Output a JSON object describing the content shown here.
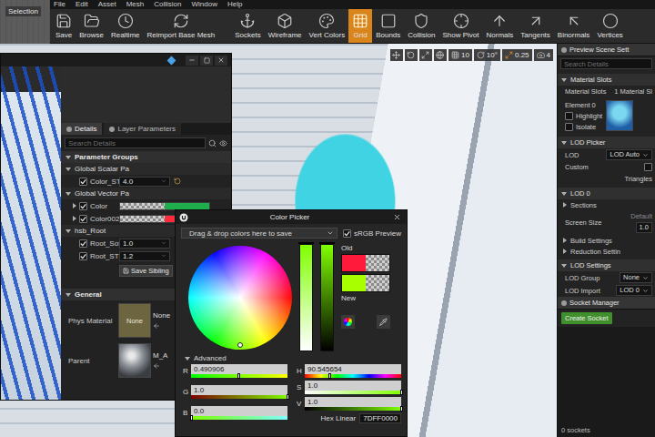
{
  "menu": [
    "File",
    "Edit",
    "Asset",
    "Mesh",
    "Collision",
    "Window",
    "Help"
  ],
  "corner_label": "Selection",
  "toolbar": [
    {
      "label": "Save",
      "selected": false
    },
    {
      "label": "Browse",
      "selected": false
    },
    {
      "label": "Realtime",
      "selected": false
    },
    {
      "label": "Reimport Base Mesh",
      "selected": false
    },
    {
      "label": "Sockets",
      "selected": false
    },
    {
      "label": "Wireframe",
      "selected": false
    },
    {
      "label": "Vert Colors",
      "selected": false
    },
    {
      "label": "Grid",
      "selected": true
    },
    {
      "label": "Bounds",
      "selected": false
    },
    {
      "label": "Collision",
      "selected": false
    },
    {
      "label": "Show Pivot",
      "selected": false
    },
    {
      "label": "Normals",
      "selected": false
    },
    {
      "label": "Tangents",
      "selected": false
    },
    {
      "label": "Binormals",
      "selected": false
    },
    {
      "label": "Vertices",
      "selected": false
    }
  ],
  "viewport_toolbar": [
    {
      "label": "10",
      "selected": false
    },
    {
      "label": "10°",
      "selected": false
    },
    {
      "label": "0.25",
      "selected": true
    },
    {
      "label": "4",
      "selected": false
    }
  ],
  "preview_scene": {
    "tab": "Preview Scene Sett",
    "search_placeholder": "Search Details",
    "material_slots": {
      "header": {
        "label": "Material Slots",
        "expanded": true
      },
      "label": "Material Slots",
      "value": "1 Material Sl",
      "element": "Element 0",
      "checkboxes": [
        {
          "label": "Highlight",
          "checked": false
        },
        {
          "label": "Isolate",
          "checked": false
        }
      ]
    },
    "lod_picker": {
      "header": {
        "label": "LOD Picker",
        "expanded": true
      },
      "lod_label": "LOD",
      "lod_value": "LOD Auto",
      "custom_label": "Custom",
      "custom_checked": false,
      "triangles": "Triangles"
    },
    "lod0": {
      "header": {
        "label": "LOD 0",
        "expanded": true
      },
      "first_group": {
        "label": "Sections",
        "expanded": false
      },
      "screen_size_label": "Screen Size",
      "screen_size_hint": "Default",
      "screen_size_value": "1.0",
      "more_groups": [
        {
          "label": "Build Settings",
          "expanded": false
        },
        {
          "label": "Reduction Settin",
          "expanded": false
        }
      ]
    },
    "lod_settings": {
      "header": {
        "label": "LOD Settings",
        "expanded": true
      },
      "rows": [
        {
          "label": "LOD Group",
          "value": "None"
        },
        {
          "label": "LOD Import",
          "value": "LOD 0"
        }
      ]
    },
    "socket_manager": {
      "tab": "Socket Manager",
      "button": "Create Socket",
      "count": "0 sockets"
    }
  },
  "material_editor": {
    "tabs": [
      {
        "label": "Details",
        "selected": true
      },
      {
        "label": "Layer Parameters",
        "selected": false
      }
    ],
    "search_placeholder": "Search Details",
    "parameter_groups_header": {
      "label": "Parameter Groups",
      "expanded": true
    },
    "groups": [
      {
        "label": "Global Scalar Pa",
        "expanded": true,
        "params": [
          {
            "kind": "scalar",
            "name": "Color_ST",
            "checked": true,
            "value": "4.0",
            "modified": true
          }
        ]
      },
      {
        "label": "Global Vector Pa",
        "expanded": true,
        "params": [
          {
            "kind": "vector",
            "name": "Color",
            "checked": true,
            "expanded": false,
            "color": "#1fae4c"
          },
          {
            "kind": "vector",
            "name": "Color002",
            "checked": true,
            "expanded": false,
            "color": "#ff2a3c"
          }
        ]
      },
      {
        "label": "hsb_Root",
        "expanded": true,
        "params": [
          {
            "kind": "scalar",
            "name": "Root_Softn",
            "checked": true,
            "value": "1.0",
            "modified": false
          },
          {
            "kind": "scalar",
            "name": "Root_ST",
            "checked": true,
            "value": "1.2",
            "modified": false
          }
        ]
      }
    ],
    "save_sibling": "Save Sibling",
    "general": {
      "label": "General",
      "expanded": true,
      "rows": [
        {
          "kind": "phys",
          "label": "Phys Material",
          "thumb_text": "None",
          "value": "None"
        },
        {
          "kind": "parent",
          "label": "Parent",
          "thumb_text": "",
          "value": "M_A"
        }
      ]
    }
  },
  "color_picker": {
    "title": "Color Picker",
    "swatch_hint": "Drag & drop colors here to save",
    "srgb": {
      "label": "sRGB Preview",
      "checked": true
    },
    "old": {
      "label": "Old",
      "color": "#ff1a3c"
    },
    "new": {
      "label": "New",
      "color": "#a8ff00"
    },
    "advanced": {
      "label": "Advanced",
      "expanded": true
    },
    "wheel": {
      "hue": 90.545654,
      "saturation": 1
    },
    "sliders": [
      {
        "name": "saturation",
        "level": 1
      },
      {
        "name": "value",
        "level": 1
      }
    ],
    "left_fields": [
      {
        "name": "R",
        "value": "0.490906",
        "level": 0.49
      },
      {
        "name": "G",
        "value": "1.0",
        "level": 1
      },
      {
        "name": "B",
        "value": "0.0",
        "level": 0
      }
    ],
    "right_fields": [
      {
        "name": "H",
        "value": "90.545654",
        "level": 0.25
      },
      {
        "name": "S",
        "value": "1.0",
        "level": 1
      },
      {
        "name": "V",
        "value": "1.0",
        "level": 1
      }
    ],
    "hex": {
      "label": "Hex Linear",
      "value": "7DFF0000"
    }
  }
}
